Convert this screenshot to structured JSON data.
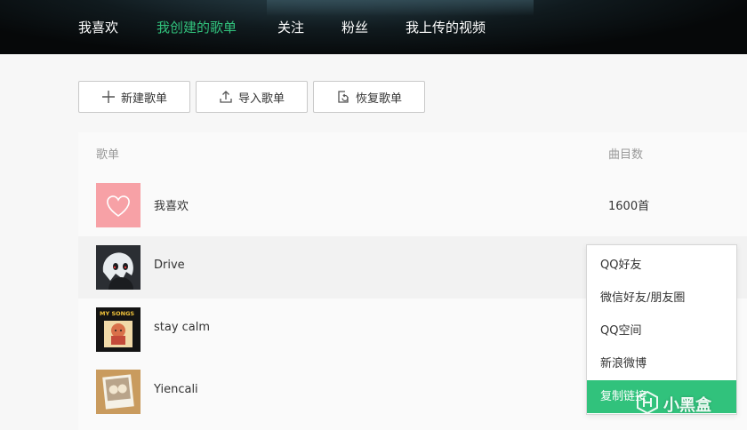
{
  "nav": {
    "items": [
      {
        "label": "我喜欢",
        "active": false
      },
      {
        "label": "我创建的歌单",
        "active": true
      },
      {
        "label": "关注",
        "active": false
      },
      {
        "label": "粉丝",
        "active": false
      },
      {
        "label": "我上传的视频",
        "active": false
      }
    ]
  },
  "toolbar": {
    "new_playlist": {
      "label": "新建歌单",
      "icon": "plus-icon"
    },
    "import_playlist": {
      "label": "导入歌单",
      "icon": "upload-icon"
    },
    "restore_playlist": {
      "label": "恢复歌单",
      "icon": "restore-icon"
    }
  },
  "table": {
    "columns": {
      "playlist": "歌单",
      "track_count": "曲目数"
    },
    "rows": [
      {
        "name": "我喜欢",
        "count": "1600首",
        "cover": "heart-cover"
      },
      {
        "name": "Drive",
        "count": "",
        "cover": "anime-cover"
      },
      {
        "name": "stay calm",
        "count": "",
        "cover": "my-songs-cover",
        "cover_text": "MY SONGS"
      },
      {
        "name": "Yiencali",
        "count": "",
        "cover": "polaroid-cover"
      }
    ]
  },
  "share_menu": {
    "items": [
      {
        "label": "QQ好友",
        "hover": false
      },
      {
        "label": "微信好友/朋友圈",
        "hover": false
      },
      {
        "label": "QQ空间",
        "hover": false
      },
      {
        "label": "新浪微博",
        "hover": false
      },
      {
        "label": "复制链接",
        "hover": true
      }
    ]
  },
  "watermark": {
    "text": "小黑盒",
    "icon": "heybox-logo-icon"
  },
  "colors": {
    "accent": "#31c27c",
    "nav_bg": "#0b1114",
    "page_bg": "#f7f7f7",
    "heart_cover_bg": "#f7a1a6"
  }
}
